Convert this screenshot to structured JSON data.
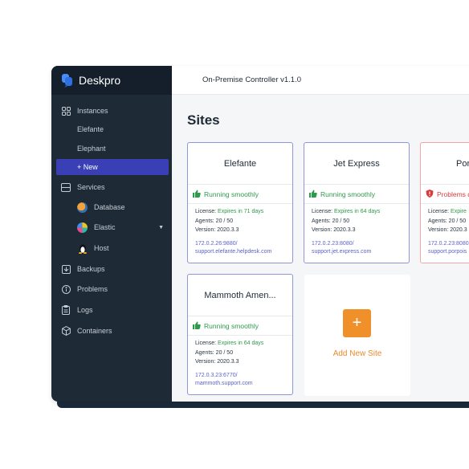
{
  "app": {
    "name": "Deskpro",
    "title": "On-Premise Controller v1.1.0"
  },
  "sidebar": {
    "instances_label": "Instances",
    "instances": [
      "Elefante",
      "Elephant"
    ],
    "new_label": "+ New",
    "services_label": "Services",
    "services": [
      {
        "label": "Database",
        "icon": "database-service-icon"
      },
      {
        "label": "Elastic",
        "icon": "elastic-service-icon",
        "expandable": true
      },
      {
        "label": "Host",
        "icon": "linux-host-icon"
      }
    ],
    "backups_label": "Backups",
    "problems_label": "Problems",
    "logs_label": "Logs",
    "containers_label": "Containers"
  },
  "page": {
    "title": "Sites"
  },
  "sites": [
    {
      "name": "Elefante",
      "status": "Running smoothly",
      "license_label": "License:",
      "license_value": "Expires in 71 days",
      "agents": "Agents: 20 / 50",
      "version": "Version: 2020.3.3",
      "address": "172.0.2.26:9880/",
      "url": "support.elefante.helpdesk.com"
    },
    {
      "name": "Jet Express",
      "status": "Running smoothly",
      "license_label": "License:",
      "license_value": "Expires in 64 days",
      "agents": "Agents: 20 / 50",
      "version": "Version: 2020.3.3",
      "address": "172.0.2.23:8080/",
      "url": "support.jet.express.com"
    },
    {
      "name": "Por",
      "status": "Problems d",
      "license_label": "License:",
      "license_value": "Expire",
      "agents": "Agents: 20 / 50",
      "version": "Version: 2020.3",
      "address": "172.0.2.23:8080",
      "url": "support.porpois"
    },
    {
      "name": "Mammoth Amen...",
      "status": "Running smoothly",
      "license_label": "License:",
      "license_value": "Expires in 64 days",
      "agents": "Agents: 20 / 50",
      "version": "Version: 2020.3.3",
      "address": "172.0.3.23:6770/",
      "url": "mammoth.support.com"
    }
  ],
  "add_site": {
    "icon": "+",
    "label": "Add New Site"
  },
  "colors": {
    "sidebar": "#1e2a36",
    "accent": "#3b3fb6",
    "ok": "#2e9a4c",
    "problem": "#d93a3a",
    "add": "#f0902a"
  }
}
